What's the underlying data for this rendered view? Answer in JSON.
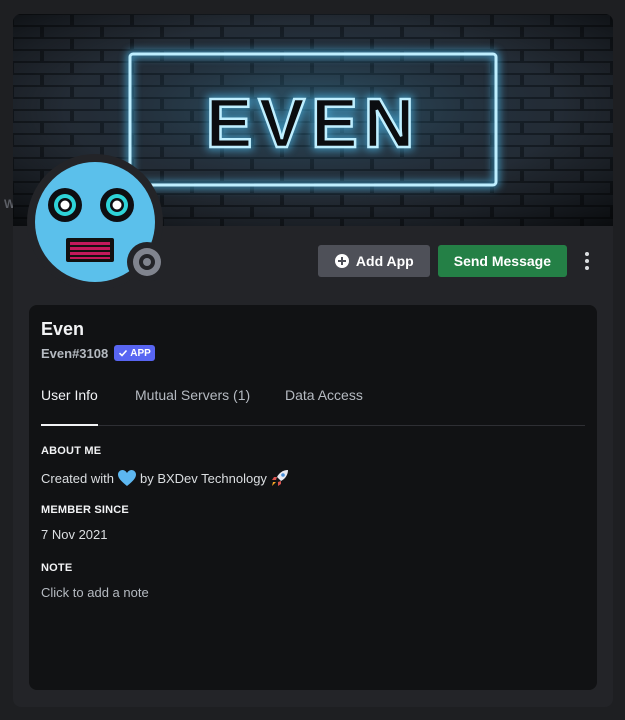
{
  "background_text": "W",
  "banner": {
    "neon_text": "EVEN"
  },
  "actions": {
    "add_app_label": "Add App",
    "send_message_label": "Send Message"
  },
  "profile": {
    "name": "Even",
    "username": "Even#3108",
    "badge": "APP"
  },
  "tabs": [
    {
      "label": "User Info",
      "active": true
    },
    {
      "label": "Mutual Servers (1)",
      "active": false
    },
    {
      "label": "Data Access",
      "active": false
    }
  ],
  "about": {
    "title": "ABOUT ME",
    "text_before": "Created with",
    "text_after": "by BXDev Technology"
  },
  "member_since": {
    "title": "MEMBER SINCE",
    "date": "7 Nov 2021"
  },
  "note": {
    "title": "NOTE",
    "placeholder": "Click to add a note"
  },
  "colors": {
    "accent": "#5865f2",
    "green": "#248046",
    "neon": "#7fd8ff",
    "avatar": "#5bc0eb"
  }
}
